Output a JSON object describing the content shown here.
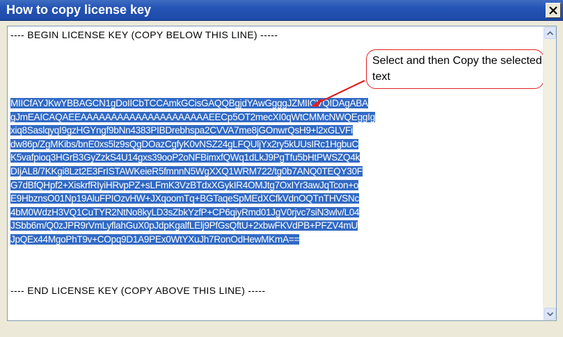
{
  "window": {
    "title": "How to copy license key",
    "close_icon": "close-icon"
  },
  "license": {
    "begin_line": "---- BEGIN LICENSE KEY (COPY BELOW THIS LINE) -----",
    "end_line": "---- END LICENSE KEY (COPY ABOVE THIS LINE) -----",
    "key_lines": [
      "MIICfAYJKwYBBAGCN1gDoIICbTCCAmkGCisGAQQBgjdYAwGgggJZMIICVQIDAgABA",
      "gJmEAICAQAEEAAAAAAAAAAAAAAAAAAAAAEECp5OT2mecXI0qWtCMMcNWQEggIg",
      "xiq8SaslqyqI9gzHGYngf9bNn4383PIBDrebhspa2CVVA7me8jGOnwrQsH9+l2xGLVFi",
      "dw86p/ZgMKibs/bnE0xs5lz9sQgDOazCgfyK0vNSZ24gLFQUljYx2ry5kUUsIRc1HgbuC",
      "K5vafpioq3HGrB3GyZzkS4U14gxs39ooP2oNFBimxfQWq1dLkJ9PgTfu5bHtPWSZQ4k",
      "DIjAL8/7KKgi8Lzt2E3FrISTAWKeieR5fmnnN5WgXXQ1WRM722/tg0b7ANQ0TEQY30F",
      "G7dBfQHpf2+XiskrfRIyiHRvpPZ+sLFmK3VzBTdxXGykIR4OMJtg7OxIYr3awJqTcon+o",
      "E9HbznsO01Np19AluFPIOzvHW+JXqoomTq+BGTaqeSpMEdXCfkVdnOQTnTHVSNc",
      "4bM0WdzH3VQ1CuTYR2NtNo8kyLD3sZbkYzfP+CP6qiyRmd01JgV0rjvc7siN3wlv/L04",
      "JSbb6m/Q0zJPR9rVmLyflahGuX0pJdpKgalfLElj9PfGsQftU+2xbwFKVdPB+PFZV4mU",
      "JpQEx44MgoPhT9v+COpq9D1A9PEx0WtYXuJh7RonOdHewMKmA=="
    ]
  },
  "callout": {
    "text": "Select and then Copy the selected text"
  },
  "scrollbar": {
    "up_icon": "scroll-up-icon",
    "down_icon": "scroll-down-icon"
  },
  "colors": {
    "title_bar": "#2454b6",
    "selection": "#316ac5",
    "callout_border": "#e02020",
    "dialog_background": "#ece9d8"
  }
}
